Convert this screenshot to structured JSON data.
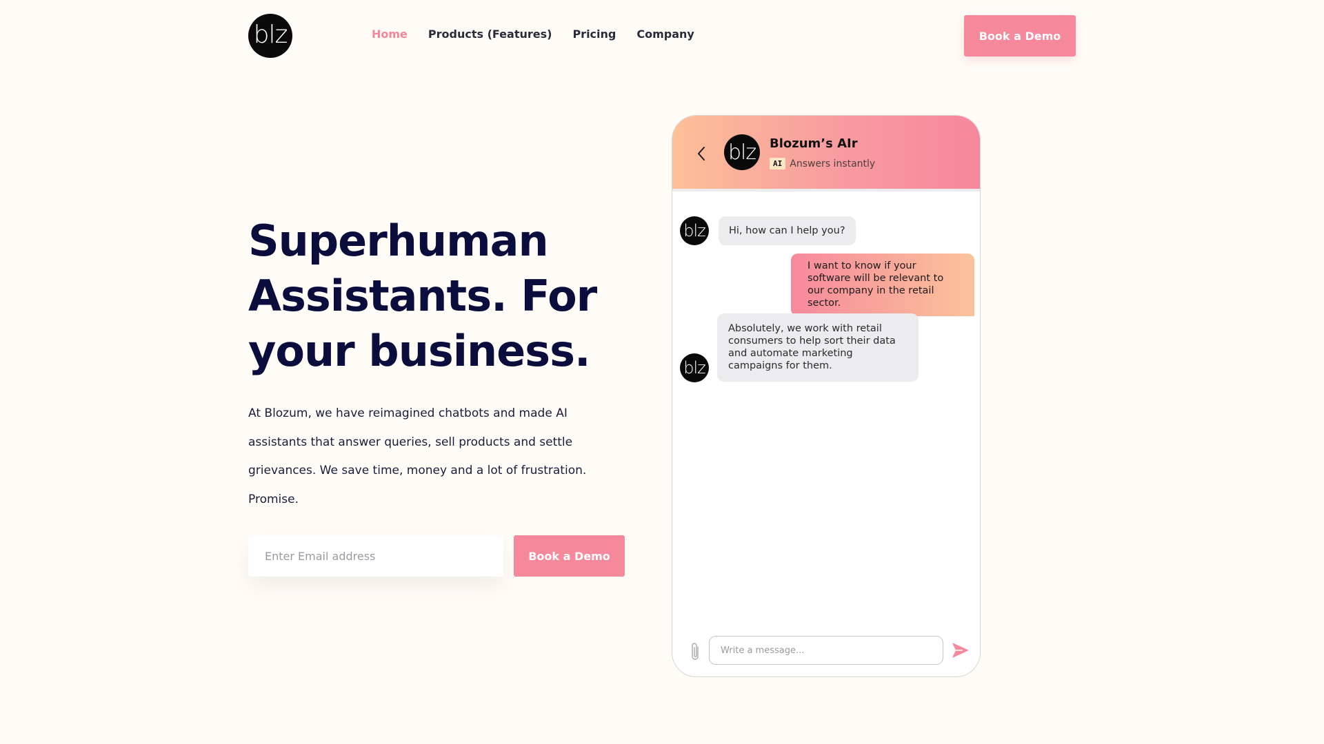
{
  "brand": {
    "logo_text": "blz"
  },
  "nav": {
    "items": [
      {
        "label": "Home",
        "active": true
      },
      {
        "label": "Products (Features)",
        "active": false
      },
      {
        "label": "Pricing",
        "active": false
      },
      {
        "label": "Company",
        "active": false
      }
    ],
    "cta_label": "Book a Demo"
  },
  "hero": {
    "title": "Superhuman Assistants. For your business.",
    "description": "At Blozum, we have reimagined chatbots and made AI assistants that answer queries, sell products and settle grievances. We save time, money and a lot of frustration. Promise.",
    "email_placeholder": "Enter Email address",
    "cta_label": "Book a Demo"
  },
  "chat": {
    "agent_name": "Blozum’s AIr",
    "badge": "AI",
    "status": "Answers instantly",
    "avatar_text": "blz",
    "messages": [
      {
        "from": "bot",
        "text": "Hi, how can I help you?"
      },
      {
        "from": "user",
        "text": "I want to know if your software will be relevant to our company in the retail sector."
      },
      {
        "from": "bot",
        "text": "Absolutely, we work with retail consumers to help sort their data and automate marketing campaigns for them."
      }
    ],
    "input_placeholder": "Write a message..."
  },
  "colors": {
    "accent": "#f5889b",
    "background": "#fffcf8",
    "heading": "#0b0d3c"
  }
}
